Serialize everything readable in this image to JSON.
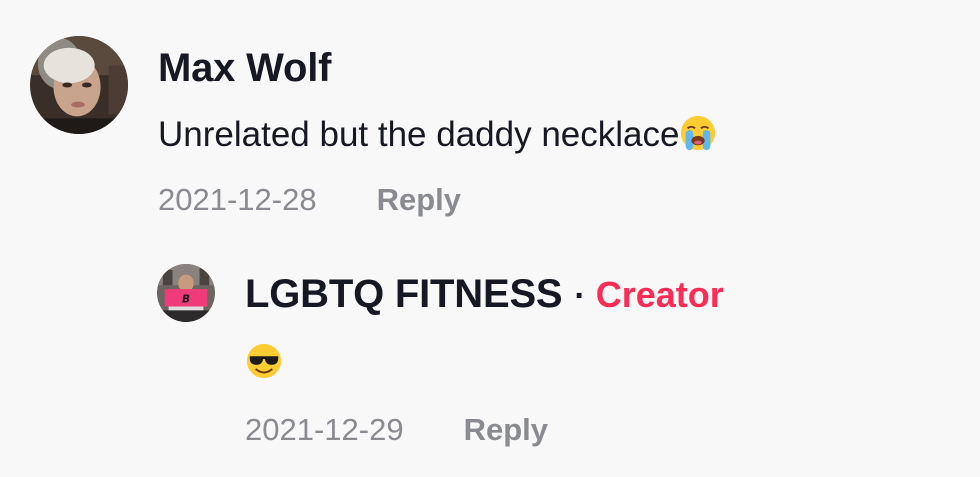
{
  "comments": [
    {
      "author": "Max Wolf",
      "text": "Unrelated but the daddy necklace",
      "emoji": "loudly-crying-face",
      "date": "2021-12-28",
      "reply_label": "Reply"
    }
  ],
  "reply": {
    "author": "LGBTQ FITNESS",
    "separator": "·",
    "badge": "Creator",
    "emoji": "smiling-face-with-sunglasses",
    "date": "2021-12-29",
    "reply_label": "Reply"
  },
  "colors": {
    "background": "#f8f8f8",
    "text": "#161823",
    "muted": "#8a8b91",
    "creator_badge": "#fe2c55"
  }
}
